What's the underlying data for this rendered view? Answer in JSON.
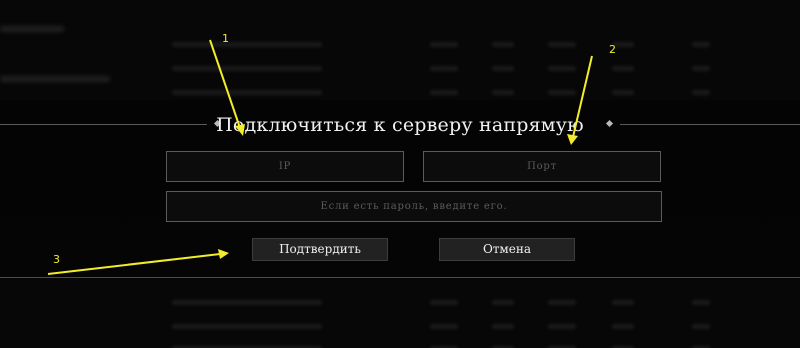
{
  "dialog": {
    "title": "Подключиться к серверу напрямую",
    "ip_field": {
      "placeholder": "IP",
      "value": ""
    },
    "port_field": {
      "placeholder": "Порт",
      "value": ""
    },
    "password_field": {
      "placeholder": "Если есть пароль, введите его.",
      "value": ""
    },
    "confirm_label": "Подтвердить",
    "cancel_label": "Отмена"
  },
  "annotations": {
    "labels": [
      "1",
      "2",
      "3"
    ],
    "color": "#f2ec2a"
  },
  "colors": {
    "background": "#070707",
    "text": "#f1f1f1",
    "field_border": "#5b5b5b",
    "button_bg": "#222222"
  }
}
